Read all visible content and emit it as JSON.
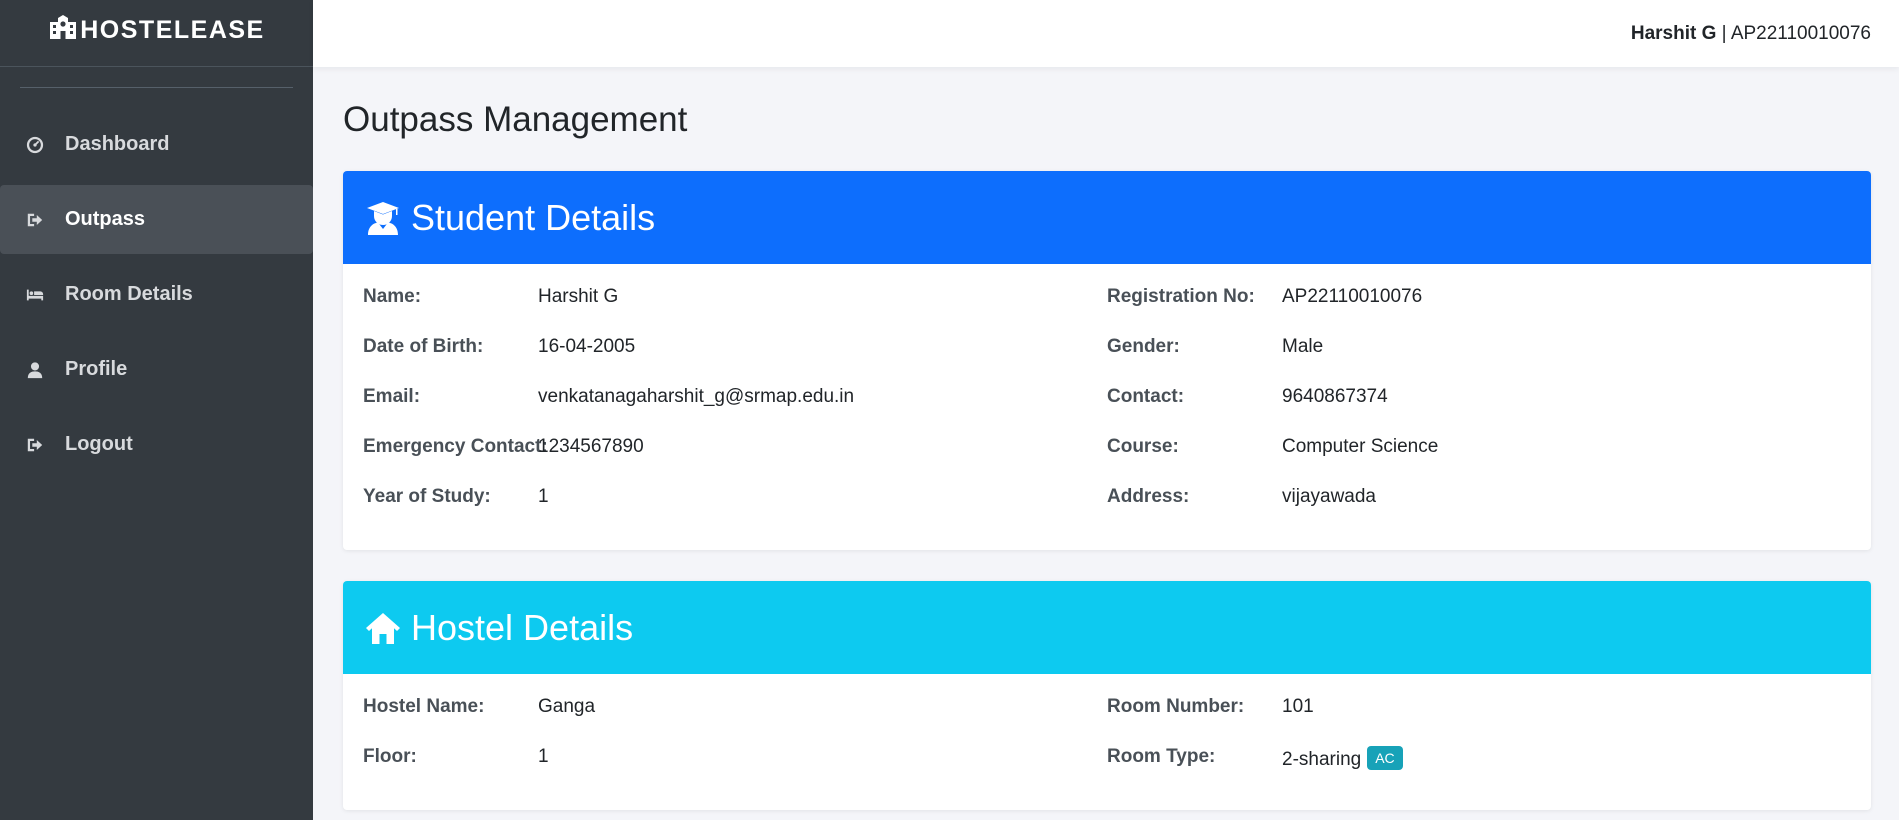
{
  "brand": {
    "name": "HOSTELEASE",
    "icon": "school-building-icon"
  },
  "sidebar": {
    "items": [
      {
        "label": "Dashboard",
        "icon": "gauge-icon",
        "active": false
      },
      {
        "label": "Outpass",
        "icon": "sign-out-icon",
        "active": true
      },
      {
        "label": "Room Details",
        "icon": "bed-icon",
        "active": false
      },
      {
        "label": "Profile",
        "icon": "user-icon",
        "active": false
      },
      {
        "label": "Logout",
        "icon": "sign-out-icon",
        "active": false
      }
    ]
  },
  "topbar": {
    "user_name": "Harshit G",
    "separator": " | ",
    "reg_no": "AP22110010076"
  },
  "page": {
    "title": "Outpass Management"
  },
  "student": {
    "header": "Student Details",
    "icon": "graduate-icon",
    "color": "#0d6efd",
    "left": [
      {
        "label": "Name:",
        "value": "Harshit G"
      },
      {
        "label": "Date of Birth:",
        "value": "16-04-2005"
      },
      {
        "label": "Email:",
        "value": "venkatanagaharshit_g@srmap.edu.in"
      },
      {
        "label": "Emergency Contact:",
        "value": "1234567890"
      },
      {
        "label": "Year of Study:",
        "value": "1"
      }
    ],
    "right": [
      {
        "label": "Registration No:",
        "value": "AP22110010076"
      },
      {
        "label": "Gender:",
        "value": "Male"
      },
      {
        "label": "Contact:",
        "value": "9640867374"
      },
      {
        "label": "Course:",
        "value": "Computer Science"
      },
      {
        "label": "Address:",
        "value": "vijayawada"
      }
    ]
  },
  "hostel": {
    "header": "Hostel Details",
    "icon": "home-icon",
    "color": "#0dcaf0",
    "left": [
      {
        "label": "Hostel Name:",
        "value": "Ganga"
      },
      {
        "label": "Floor:",
        "value": "1"
      }
    ],
    "right": [
      {
        "label": "Room Number:",
        "value": "101"
      },
      {
        "label": "Room Type:",
        "value": "2-sharing",
        "badge": "AC"
      }
    ]
  }
}
